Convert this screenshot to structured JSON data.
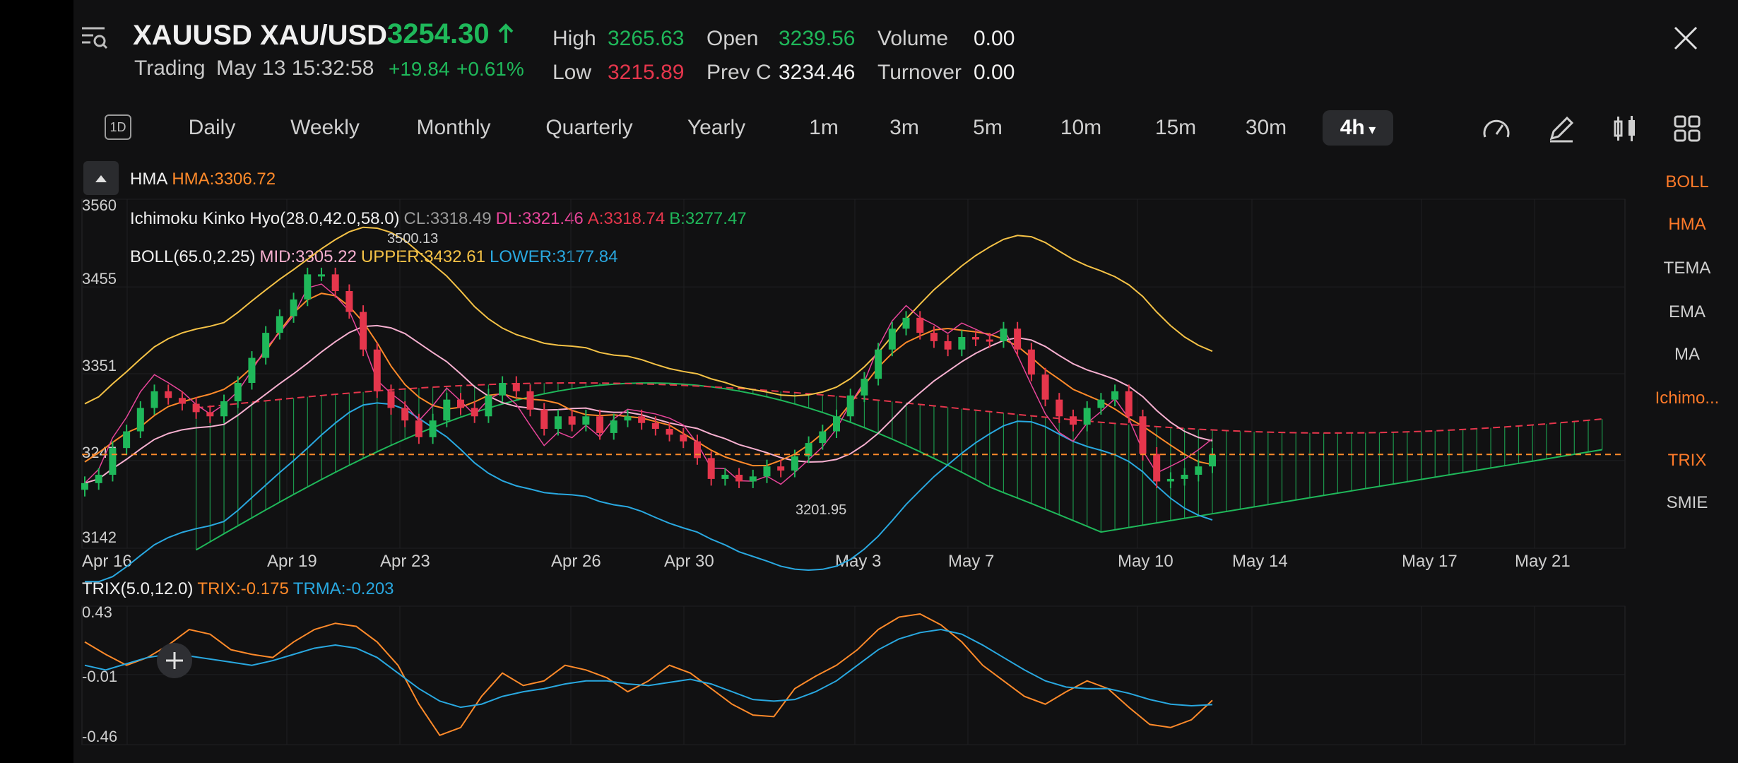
{
  "header": {
    "symbol": "XAUUSD XAU/USD",
    "price": "3254.30",
    "status": "Trading",
    "datetime": "May 13 15:32:58",
    "change": "+19.84",
    "change_pct": "+0.61%",
    "stats": {
      "high_label": "High",
      "high": "3265.63",
      "open_label": "Open",
      "open": "3239.56",
      "volume_label": "Volume",
      "volume": "0.00",
      "low_label": "Low",
      "low": "3215.89",
      "prevc_label": "Prev C",
      "prevc": "3234.46",
      "turnover_label": "Turnover",
      "turnover": "0.00"
    }
  },
  "toolbar": {
    "period_icon_label": "1D",
    "tabs": [
      "Daily",
      "Weekly",
      "Monthly",
      "Quarterly",
      "Yearly",
      "1m",
      "3m",
      "5m",
      "10m",
      "15m",
      "30m",
      "4h"
    ],
    "active_tab": "4h"
  },
  "indicators": {
    "hma_name": "HMA",
    "hma_value": "HMA:3306.72",
    "ichimoku_name": "Ichimoku Kinko Hyo(28.0,42.0,58.0)",
    "cl": "CL:3318.49",
    "dl": "DL:3321.46",
    "a": "A:3318.74",
    "b": "B:3277.47",
    "boll_name": "BOLL(65.0,2.25)",
    "mid": "MID:3305.22",
    "upper": "UPPER:3432.61",
    "lower": "LOWER:3177.84",
    "trix_name": "TRIX(5.0,12.0)",
    "trix": "TRIX:-0.175",
    "trma": "TRMA:-0.203"
  },
  "sidebar": {
    "items": [
      {
        "label": "BOLL",
        "active": true
      },
      {
        "label": "HMA",
        "active": true
      },
      {
        "label": "TEMA",
        "active": false
      },
      {
        "label": "EMA",
        "active": false
      },
      {
        "label": "MA",
        "active": false
      },
      {
        "label": "Ichimo...",
        "active": true
      },
      {
        "label": "TRIX",
        "active": true
      },
      {
        "label": "SMIE",
        "active": false
      }
    ]
  },
  "colors": {
    "up": "#1fb85a",
    "down": "#e5364c",
    "boll_upper": "#f5c246",
    "boll_mid": "#f7b0d0",
    "boll_lower": "#29a8e0",
    "hma": "#ff8a2a",
    "ichimoku_cl": "#9a9a9a",
    "ichimoku_dl": "#e8459a",
    "trix": "#ff8a2a",
    "trma": "#29a8e0",
    "accent": "#ff7a29"
  },
  "chart_data": [
    {
      "type": "candlestick",
      "y_ticks": [
        "3560",
        "3455",
        "3351",
        "3247",
        "3142"
      ],
      "ylim": [
        3142,
        3560
      ],
      "x_ticks": [
        "Apr 16",
        "Apr 19",
        "Apr 23",
        "Apr 26",
        "Apr 30",
        "May 3",
        "May 7",
        "May 10",
        "May 14",
        "May 17",
        "May 21"
      ],
      "annotations": [
        "3500.13",
        "3201.95"
      ],
      "current_price": 3254.3,
      "closes": [
        3220,
        3230,
        3262,
        3282,
        3310,
        3330,
        3322,
        3315,
        3305,
        3300,
        3318,
        3340,
        3370,
        3400,
        3420,
        3440,
        3470,
        3470,
        3450,
        3425,
        3380,
        3330,
        3310,
        3295,
        3275,
        3295,
        3320,
        3310,
        3300,
        3325,
        3340,
        3330,
        3308,
        3285,
        3300,
        3290,
        3300,
        3280,
        3295,
        3300,
        3292,
        3285,
        3278,
        3270,
        3250,
        3225,
        3230,
        3222,
        3228,
        3240,
        3235,
        3252,
        3268,
        3282,
        3300,
        3325,
        3345,
        3380,
        3405,
        3418,
        3400,
        3390,
        3380,
        3395,
        3392,
        3390,
        3405,
        3380,
        3350,
        3320,
        3300,
        3290,
        3310,
        3320,
        3330,
        3300,
        3255,
        3222,
        3225,
        3230,
        3240,
        3254
      ],
      "grid": true
    },
    {
      "type": "line",
      "y_ticks": [
        "0.43",
        "-0.01",
        "-0.46"
      ],
      "ylim": [
        -0.46,
        0.43
      ],
      "series": [
        {
          "name": "TRIX",
          "values": [
            0.2,
            0.12,
            0.05,
            0.1,
            0.18,
            0.28,
            0.25,
            0.15,
            0.12,
            0.1,
            0.2,
            0.28,
            0.32,
            0.3,
            0.2,
            0.05,
            -0.2,
            -0.4,
            -0.35,
            -0.15,
            0.0,
            -0.08,
            -0.05,
            0.05,
            0.02,
            -0.03,
            -0.12,
            -0.05,
            0.05,
            0.0,
            -0.1,
            -0.2,
            -0.27,
            -0.28,
            -0.1,
            -0.02,
            0.05,
            0.15,
            0.28,
            0.36,
            0.38,
            0.31,
            0.2,
            0.05,
            -0.05,
            -0.15,
            -0.2,
            -0.12,
            -0.05,
            -0.1,
            -0.22,
            -0.33,
            -0.35,
            -0.3,
            -0.175
          ]
        },
        {
          "name": "TRMA",
          "values": [
            0.05,
            0.02,
            0.06,
            0.1,
            0.12,
            0.11,
            0.09,
            0.07,
            0.05,
            0.08,
            0.12,
            0.16,
            0.18,
            0.16,
            0.1,
            0.0,
            -0.1,
            -0.18,
            -0.22,
            -0.2,
            -0.15,
            -0.12,
            -0.1,
            -0.07,
            -0.05,
            -0.05,
            -0.07,
            -0.08,
            -0.06,
            -0.04,
            -0.07,
            -0.12,
            -0.17,
            -0.18,
            -0.17,
            -0.12,
            -0.05,
            0.05,
            0.15,
            0.22,
            0.26,
            0.28,
            0.25,
            0.18,
            0.1,
            0.02,
            -0.05,
            -0.09,
            -0.1,
            -0.1,
            -0.13,
            -0.17,
            -0.2,
            -0.21,
            -0.203
          ]
        }
      ],
      "grid": true
    }
  ]
}
